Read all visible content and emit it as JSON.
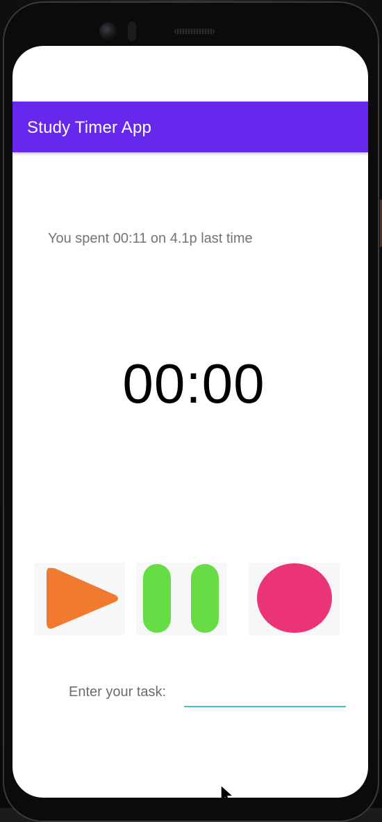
{
  "app_bar": {
    "title": "Study Timer App",
    "color": "#6728ED"
  },
  "last_session": {
    "text": "You spent 00:11 on 4.1p last time"
  },
  "timer": {
    "display": "00:00"
  },
  "controls": {
    "play_icon": "play-icon",
    "pause_icon": "pause-icon",
    "stop_icon": "stop-icon",
    "play_color": "#F07A30",
    "pause_color": "#66DD44",
    "stop_color": "#EB3378"
  },
  "task": {
    "label": "Enter your task:",
    "value": "",
    "underline_color": "#3DCBB5"
  }
}
